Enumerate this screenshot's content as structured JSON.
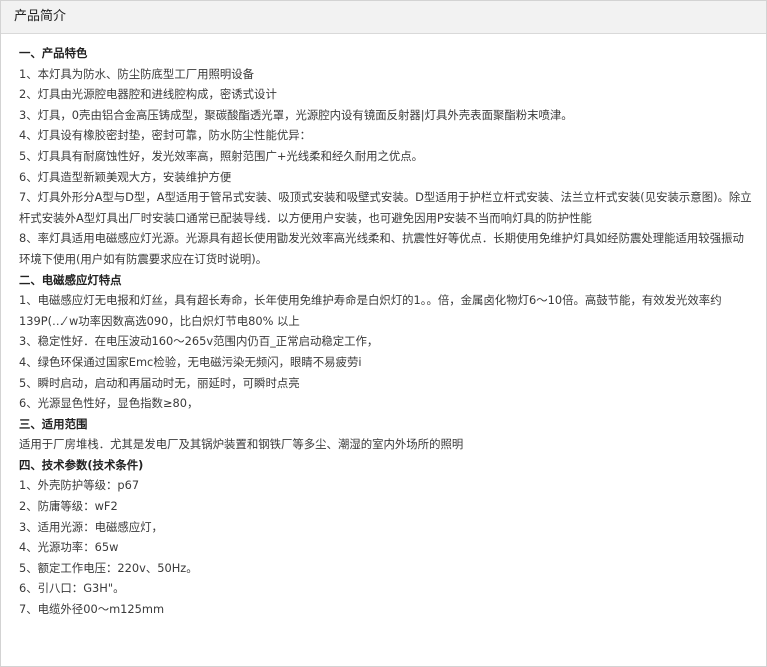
{
  "panel": {
    "title": "产品简介"
  },
  "lines": [
    {
      "text": "一、产品特色",
      "kind": "heading"
    },
    {
      "text": "1、本灯具为防水、防尘防底型工厂用照明设备",
      "kind": "item"
    },
    {
      "text": "2、灯具由光源腔电器腔和进线腔构成，密诱式设计",
      "kind": "item"
    },
    {
      "text": "3、灯具，0壳由铝合金高压铸成型，聚碳酸酯透光罩，光源腔内设有镜面反射器|灯具外壳表面聚酯粉末喷津。",
      "kind": "item"
    },
    {
      "text": "4、灯具设有橡胶密封垫，密封可靠，防水防尘性能优异：",
      "kind": "item"
    },
    {
      "text": "5、灯具具有耐腐蚀性好，发光效率高，照射范围广+光线柔和经久耐用之优点。",
      "kind": "item"
    },
    {
      "text": "6、灯具造型新颖美观大方，安装维护方便",
      "kind": "item"
    },
    {
      "text": "7、灯具外形分A型与D型，A型适用于管吊式安装、吸顶式安装和吸壁式安装。D型适用于护栏立杆式安装、法兰立杆式安装(见安装示意图)。除立杆式安装外A型灯具出厂时安装口通常已配装导线．以方便用户安装，也可避免因用P安装不当而响灯具的防护性能",
      "kind": "wrap"
    },
    {
      "text": "8、率灯具适用电磁感应灯光源。光源具有超长使用勖发光效率高光线柔和、抗震性好等优点．长期使用免维护灯具如经防震处理能适用较强振动环境下使用(用户如有防震要求应在订货时说明)。",
      "kind": "wrap"
    },
    {
      "text": "二、电磁感应灯特点",
      "kind": "heading"
    },
    {
      "text": "1、电磁感应灯无电报和灯丝，具有超长寿命，长年使用免维护寿命是白炽灯的1。。倍，金属卤化物灯6～10倍。高鼓节能，有效发光效率约139P(…⁄ w功率因数高选090，比白炽灯节电80% 以上",
      "kind": "wrap"
    },
    {
      "text": "3、稳定性好．在电压波动160～265v范围内仍百_正常启动稳定工作，",
      "kind": "item"
    },
    {
      "text": "4、绿色环保通过国家Emc检验，无电磁污染无频闪，眼睛不易疲劳i",
      "kind": "item"
    },
    {
      "text": "5、瞬时启动，启动和再届动时无，丽延时，可瞬时点亮",
      "kind": "item"
    },
    {
      "text": "6、光源显色性好，显色指数≥80，",
      "kind": "item"
    },
    {
      "text": "三、适用范围",
      "kind": "heading"
    },
    {
      "text": "适用于厂房堆栈．尤其是发电厂及其锅炉装置和钢铁厂等多尘、潮湿的室内外场所的照明",
      "kind": "item"
    },
    {
      "text": "四、技术参数(技术条件)",
      "kind": "heading"
    },
    {
      "text": "1、外壳防护等级：p67",
      "kind": "item"
    },
    {
      "text": "2、防庸等级：wF2",
      "kind": "item"
    },
    {
      "text": "3、适用光源：电磁感应灯，",
      "kind": "item"
    },
    {
      "text": "4、光源功率：65w",
      "kind": "item"
    },
    {
      "text": "5、额定工作电压：220v、50Hz。",
      "kind": "item"
    },
    {
      "text": "6、引八口：G3H\"。",
      "kind": "item"
    },
    {
      "text": "7、电缆外径00～m125mm",
      "kind": "item"
    }
  ]
}
